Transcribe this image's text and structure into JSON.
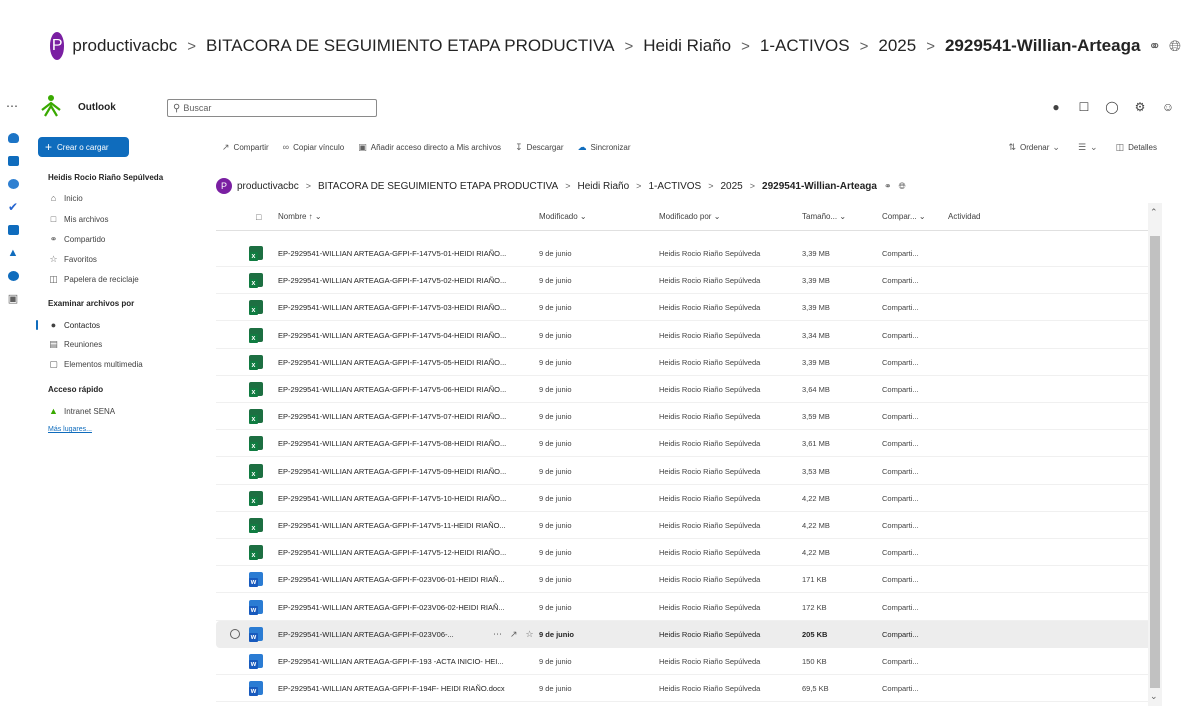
{
  "big_breadcrumb": {
    "avatar_letter": "P",
    "items": [
      "productivacbc",
      "BITACORA DE SEGUIMIENTO ETAPA PRODUCTIVA",
      "Heidi Riaño",
      "1-ACTIVOS",
      "2025",
      "2929541-Willian-Arteaga"
    ],
    "separator": ">"
  },
  "topbar": {
    "app_name": "Outlook",
    "search_placeholder": "Buscar"
  },
  "nav": {
    "create_label": "Crear o cargar",
    "user_name": "Heidis Rocio Riaño Sepúlveda",
    "items": [
      {
        "label": "Inicio",
        "icon": "home-icon"
      },
      {
        "label": "Mis archivos",
        "icon": "folder-icon"
      },
      {
        "label": "Compartido",
        "icon": "people-icon"
      },
      {
        "label": "Favoritos",
        "icon": "star-icon"
      },
      {
        "label": "Papelera de reciclaje",
        "icon": "trash-icon"
      }
    ],
    "browse_heading": "Examinar archivos por",
    "browse_items": [
      {
        "label": "Contactos",
        "icon": "person-icon"
      },
      {
        "label": "Reuniones",
        "icon": "calendar-icon"
      },
      {
        "label": "Elementos multimedia",
        "icon": "image-icon"
      }
    ],
    "quick_heading": "Acceso rápido",
    "quick_items": [
      {
        "label": "Intranet SENA",
        "icon": "sena-icon"
      }
    ],
    "more_places": "Más lugares..."
  },
  "commands": {
    "share": "Compartir",
    "copy_link": "Copiar vínculo",
    "add_shortcut": "Añadir acceso directo a Mis archivos",
    "download": "Descargar",
    "sync": "Sincronizar",
    "sort": "Ordenar",
    "details": "Detalles"
  },
  "inner_breadcrumb": {
    "avatar_letter": "P",
    "items": [
      "productivacbc",
      "BITACORA DE SEGUIMIENTO ETAPA PRODUCTIVA",
      "Heidi Riaño",
      "1-ACTIVOS",
      "2025",
      "2929541-Willian-Arteaga"
    ],
    "separator": ">"
  },
  "columns": {
    "name": "Nombre",
    "modified": "Modificado",
    "modified_by": "Modificado por",
    "size": "Tamaño...",
    "shared": "Compar...",
    "activity": "Actividad"
  },
  "files": [
    {
      "type": "excel",
      "name": "EP-2929541-WILLIAN ARTEAGA-GFPI-F-147V5-01-HEIDI RIAÑO...",
      "modified": "9 de junio",
      "by": "Heidis Rocio Riaño Sepúlveda",
      "size": "3,39 MB",
      "shared": "Comparti..."
    },
    {
      "type": "excel",
      "name": "EP-2929541-WILLIAN ARTEAGA-GFPI-F-147V5-02-HEIDI RIAÑO...",
      "modified": "9 de junio",
      "by": "Heidis Rocio Riaño Sepúlveda",
      "size": "3,39 MB",
      "shared": "Comparti..."
    },
    {
      "type": "excel",
      "name": "EP-2929541-WILLIAN ARTEAGA-GFPI-F-147V5-03-HEIDI RIAÑO...",
      "modified": "9 de junio",
      "by": "Heidis Rocio Riaño Sepúlveda",
      "size": "3,39 MB",
      "shared": "Comparti..."
    },
    {
      "type": "excel",
      "name": "EP-2929541-WILLIAN ARTEAGA-GFPI-F-147V5-04-HEIDI RIAÑO...",
      "modified": "9 de junio",
      "by": "Heidis Rocio Riaño Sepúlveda",
      "size": "3,34 MB",
      "shared": "Comparti..."
    },
    {
      "type": "excel",
      "name": "EP-2929541-WILLIAN ARTEAGA-GFPI-F-147V5-05-HEIDI RIAÑO...",
      "modified": "9 de junio",
      "by": "Heidis Rocio Riaño Sepúlveda",
      "size": "3,39 MB",
      "shared": "Comparti..."
    },
    {
      "type": "excel",
      "name": "EP-2929541-WILLIAN ARTEAGA-GFPI-F-147V5-06-HEIDI RIAÑO...",
      "modified": "9 de junio",
      "by": "Heidis Rocio Riaño Sepúlveda",
      "size": "3,64 MB",
      "shared": "Comparti..."
    },
    {
      "type": "excel",
      "name": "EP-2929541-WILLIAN ARTEAGA-GFPI-F-147V5-07-HEIDI RIAÑO...",
      "modified": "9 de junio",
      "by": "Heidis Rocio Riaño Sepúlveda",
      "size": "3,59 MB",
      "shared": "Comparti..."
    },
    {
      "type": "excel",
      "name": "EP-2929541-WILLIAN ARTEAGA-GFPI-F-147V5-08-HEIDI RIAÑO...",
      "modified": "9 de junio",
      "by": "Heidis Rocio Riaño Sepúlveda",
      "size": "3,61 MB",
      "shared": "Comparti..."
    },
    {
      "type": "excel",
      "name": "EP-2929541-WILLIAN ARTEAGA-GFPI-F-147V5-09-HEIDI RIAÑO...",
      "modified": "9 de junio",
      "by": "Heidis Rocio Riaño Sepúlveda",
      "size": "3,53 MB",
      "shared": "Comparti..."
    },
    {
      "type": "excel",
      "name": "EP-2929541-WILLIAN ARTEAGA-GFPI-F-147V5-10-HEIDI RIAÑO...",
      "modified": "9 de junio",
      "by": "Heidis Rocio Riaño Sepúlveda",
      "size": "4,22 MB",
      "shared": "Comparti..."
    },
    {
      "type": "excel",
      "name": "EP-2929541-WILLIAN ARTEAGA-GFPI-F-147V5-11-HEIDI RIAÑO...",
      "modified": "9 de junio",
      "by": "Heidis Rocio Riaño Sepúlveda",
      "size": "4,22 MB",
      "shared": "Comparti..."
    },
    {
      "type": "excel",
      "name": "EP-2929541-WILLIAN ARTEAGA-GFPI-F-147V5-12-HEIDI RIAÑO...",
      "modified": "9 de junio",
      "by": "Heidis Rocio Riaño Sepúlveda",
      "size": "4,22 MB",
      "shared": "Comparti..."
    },
    {
      "type": "word",
      "name": "EP-2929541-WILLIAN ARTEAGA-GFPI-F-023V06-01-HEIDI RIAÑ...",
      "modified": "9 de junio",
      "by": "Heidis Rocio Riaño Sepúlveda",
      "size": "171 KB",
      "shared": "Comparti..."
    },
    {
      "type": "word",
      "name": "EP-2929541-WILLIAN ARTEAGA-GFPI-F-023V06-02-HEIDI RIAÑ...",
      "modified": "9 de junio",
      "by": "Heidis Rocio Riaño Sepúlveda",
      "size": "172 KB",
      "shared": "Comparti..."
    },
    {
      "type": "word",
      "name": "EP-2929541-WILLIAN ARTEAGA-GFPI-F-023V06-...",
      "modified": "9 de junio",
      "by": "Heidis Rocio Riaño Sepúlveda",
      "size": "205 KB",
      "shared": "Comparti...",
      "selected": true
    },
    {
      "type": "word",
      "name": "EP-2929541-WILLIAN ARTEAGA-GFPI-F-193 -ACTA INICIO- HEI...",
      "modified": "9 de junio",
      "by": "Heidis Rocio Riaño Sepúlveda",
      "size": "150 KB",
      "shared": "Comparti..."
    },
    {
      "type": "word",
      "name": "EP-2929541-WILLIAN ARTEAGA-GFPI-F-194F- HEIDI RIAÑO.docx",
      "modified": "9 de junio",
      "by": "Heidis Rocio Riaño Sepúlveda",
      "size": "69,5 KB",
      "shared": "Comparti..."
    }
  ],
  "colors": {
    "accent": "#0f6cbd",
    "avatar": "#7a1fa2",
    "excel": "#107c41",
    "word": "#185abd"
  }
}
